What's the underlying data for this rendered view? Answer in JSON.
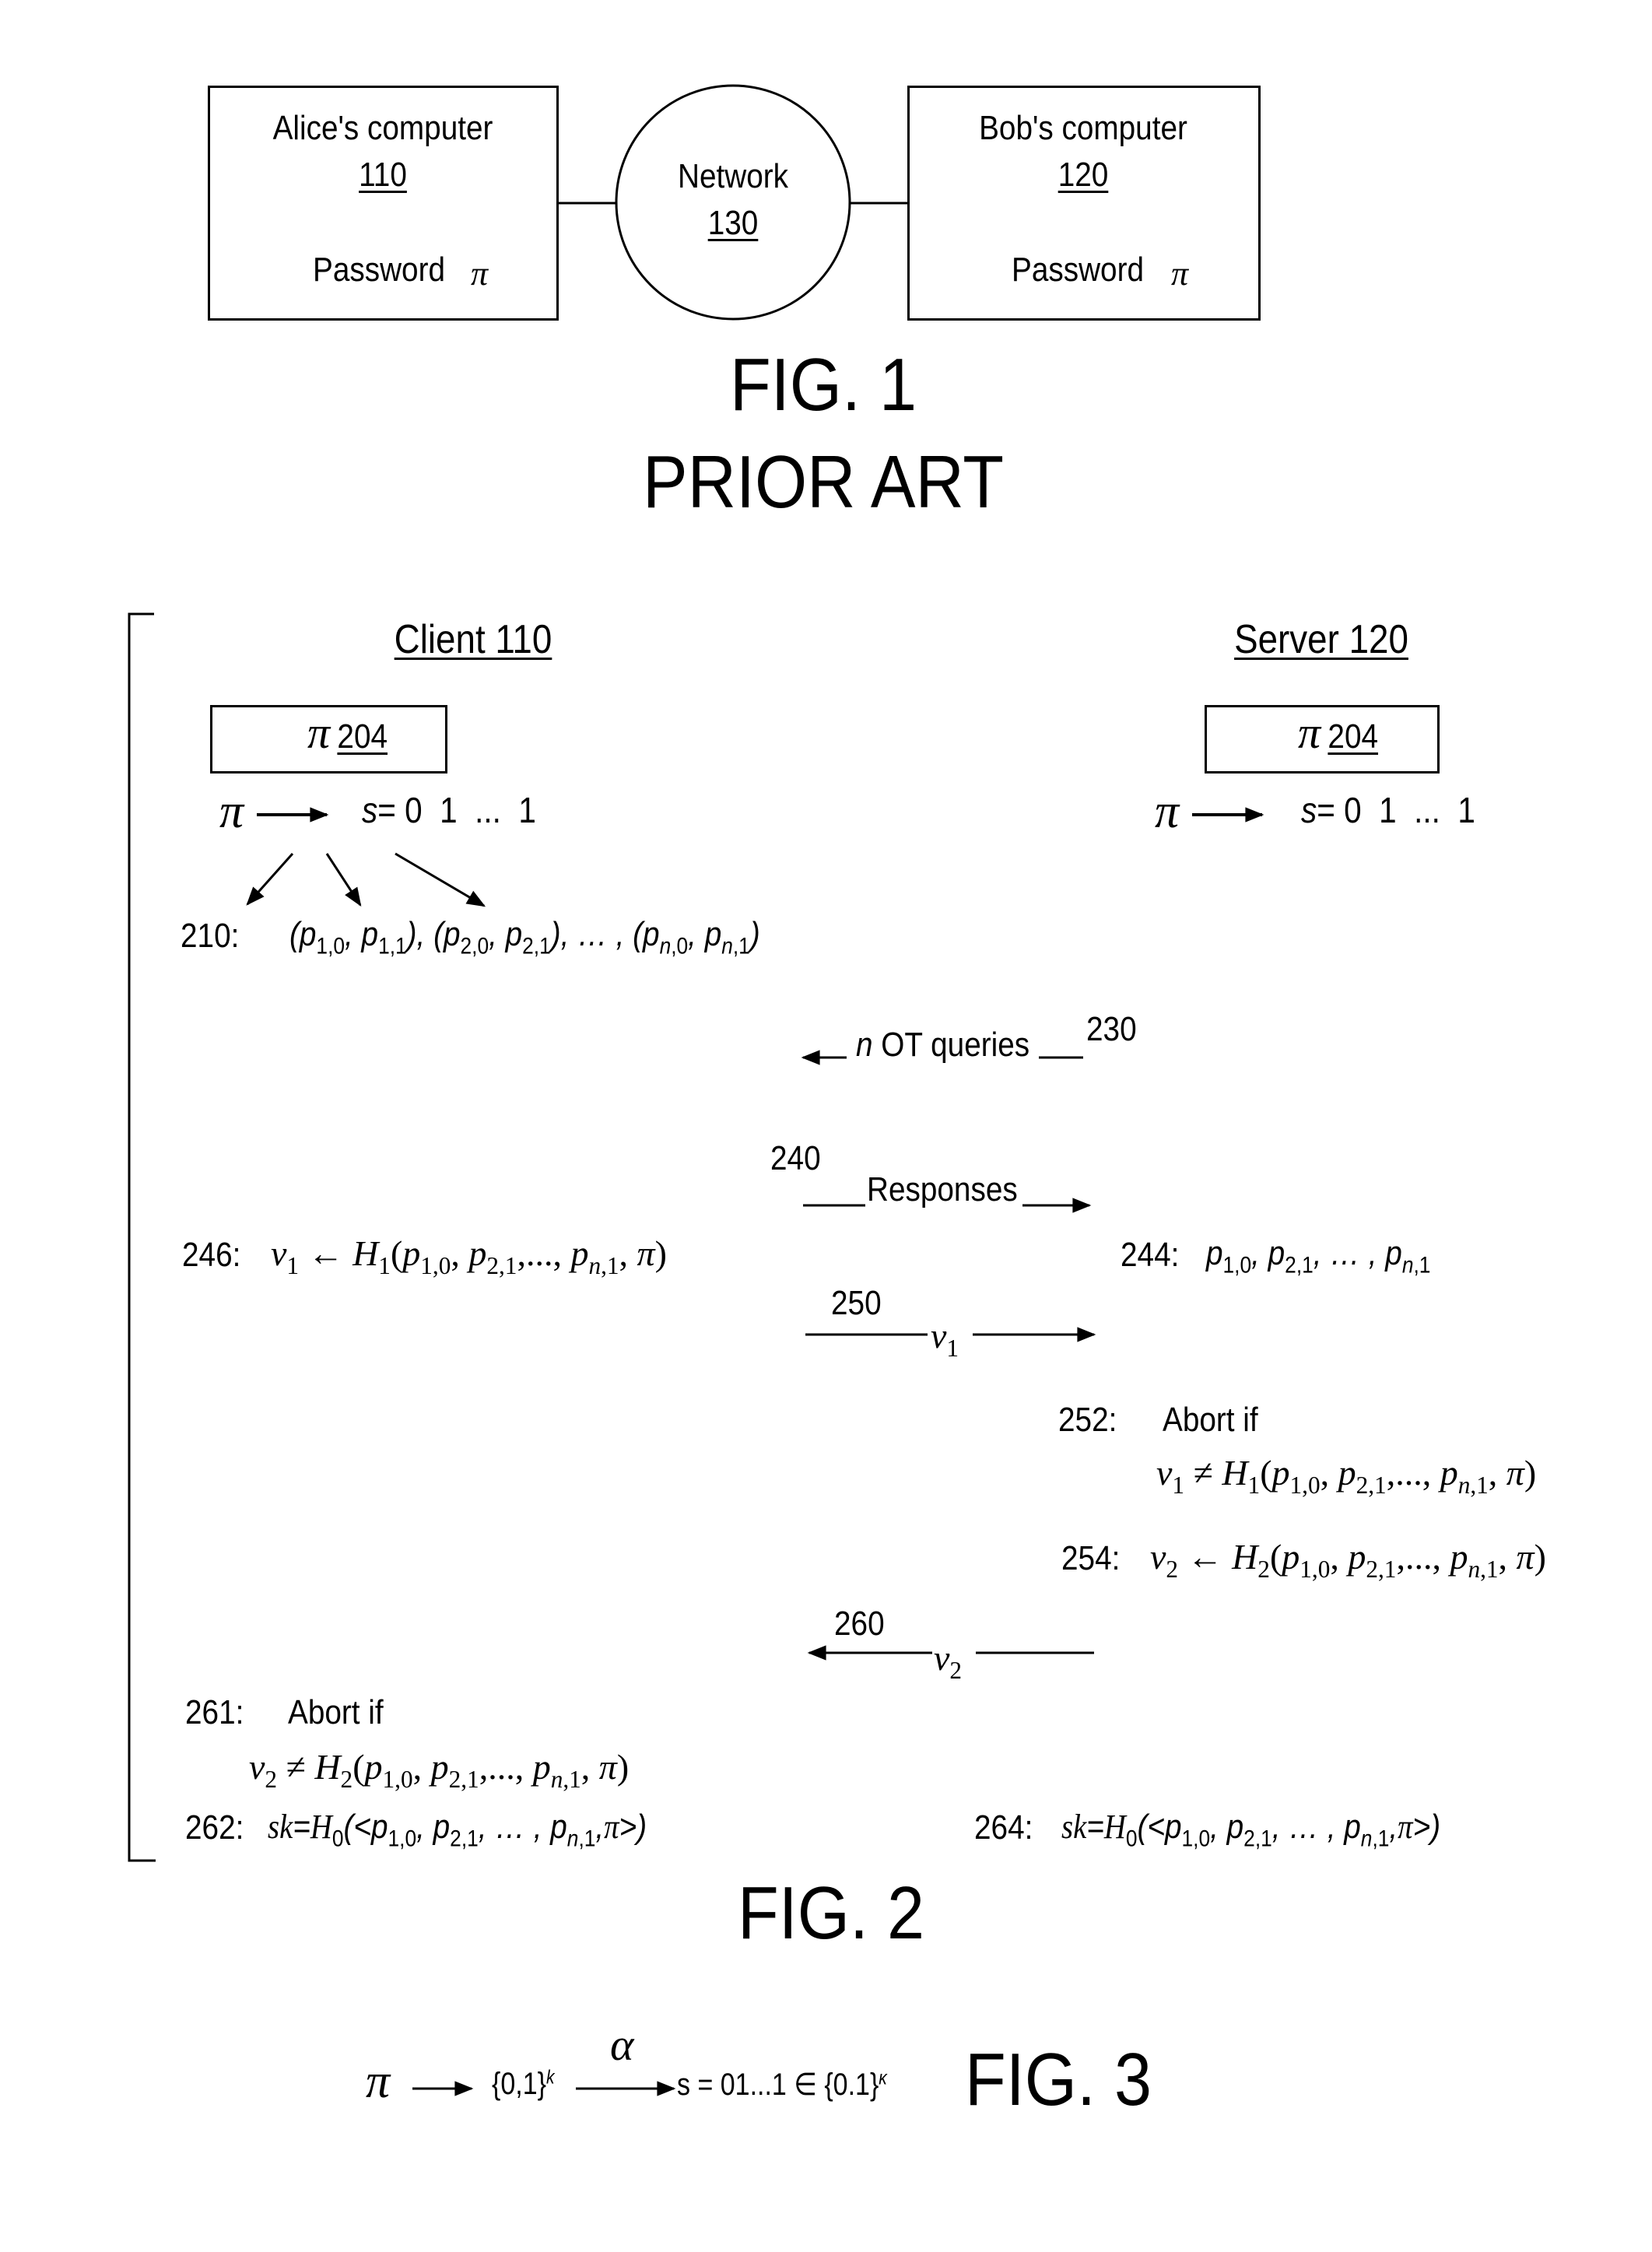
{
  "fig1": {
    "alice": {
      "title": "Alice's computer",
      "ref": "110",
      "password_label": "Password",
      "password_symbol": "π"
    },
    "network": {
      "title": "Network",
      "ref": "130"
    },
    "bob": {
      "title": "Bob's computer",
      "ref": "120",
      "password_label": "Password",
      "password_symbol": "π"
    },
    "caption": "FIG. 1",
    "subcaption": "PRIOR ART"
  },
  "fig2": {
    "client": {
      "title": "Client 110",
      "password_box": {
        "symbol": "π",
        "ref": "204"
      }
    },
    "server": {
      "title": "Server 120",
      "password_box": {
        "symbol": "π",
        "ref": "204"
      }
    },
    "client_mapping": {
      "pi": "π",
      "arrow": "→",
      "s": "s",
      "bits": "= 0  1  ...  1"
    },
    "server_mapping": {
      "pi": "π",
      "arrow": "→",
      "s": "s",
      "bits": "= 0  1  ...  1"
    },
    "step_210": {
      "label": "210:",
      "expr": "(p1,0, p1,1), (p2,0, p2,1), ... , (pn,0, pn,1)"
    },
    "msg_230": {
      "label": "n OT queries",
      "n": "n",
      "text": " OT queries",
      "ref": "230",
      "direction": "left"
    },
    "msg_240": {
      "label": "Responses",
      "ref": "240",
      "direction": "right"
    },
    "step_246": {
      "label": "246:",
      "expr": "v1 ← H1(p1,0, p2,1, ..., pn,1, π)"
    },
    "step_244": {
      "label": "244:",
      "expr": "p1,0, p2,1, ... , pn,1"
    },
    "msg_250": {
      "label": "v1",
      "ref": "250",
      "direction": "right"
    },
    "step_252": {
      "label": "252:",
      "text": "Abort if",
      "expr": "v1 ≠ H1(p1,0, p2,1, ..., pn,1, π)"
    },
    "step_254": {
      "label": "254:",
      "expr": "v2 ← H2(p1,0, p2,1, ..., pn,1, π)"
    },
    "msg_260": {
      "label": "v2",
      "ref": "260",
      "direction": "left"
    },
    "step_261": {
      "label": "261:",
      "text": "Abort if",
      "expr": "v2 ≠ H2(p1,0, p2,1, ..., pn,1, π)"
    },
    "step_262": {
      "label": "262:",
      "expr": "sk=H0(<p1,0, p2,1, ... , pn,1, π>)"
    },
    "step_264": {
      "label": "264:",
      "expr": "sk=H0(<p1,0, p2,1, ... , pn,1, π>)"
    },
    "caption": "FIG. 2"
  },
  "fig3": {
    "pi": "π",
    "set": "{0,1}",
    "set_exp": "k",
    "alpha": "α",
    "result": "s = 01...1 ∈ {0.1}",
    "result_exp": "κ",
    "caption": "FIG. 3"
  }
}
